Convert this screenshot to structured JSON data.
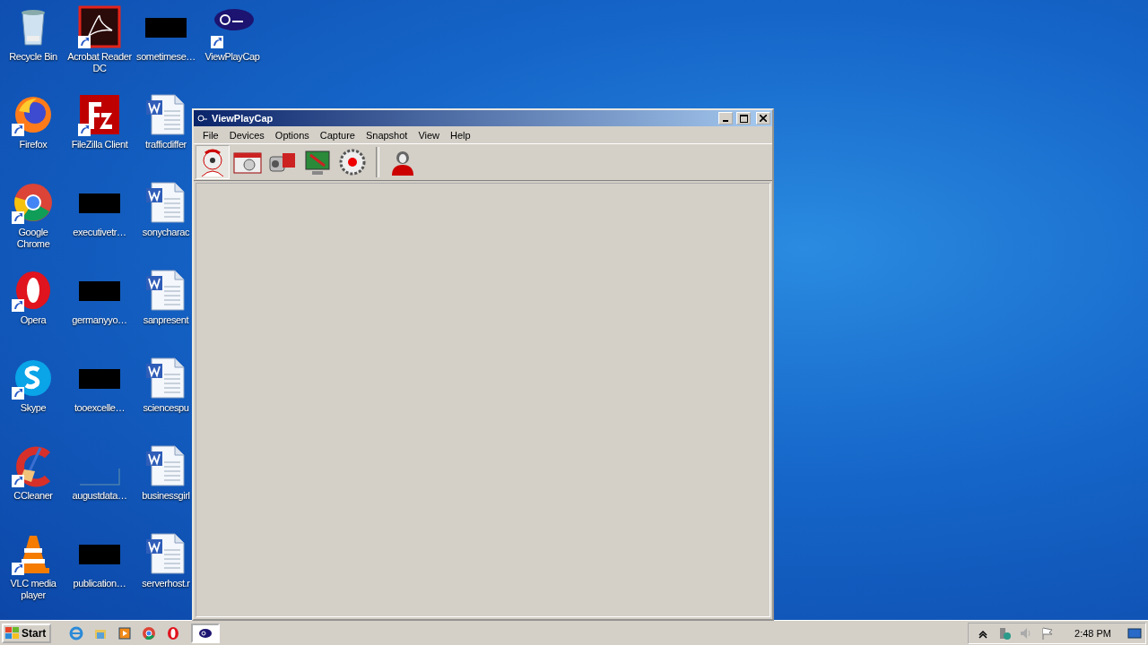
{
  "desktop_icons": [
    {
      "label": "Recycle Bin",
      "kind": "recycle",
      "shortcut": false
    },
    {
      "label": "Firefox",
      "kind": "firefox",
      "shortcut": true
    },
    {
      "label": "Google Chrome",
      "kind": "chrome",
      "shortcut": true
    },
    {
      "label": "Opera",
      "kind": "opera",
      "shortcut": true
    },
    {
      "label": "Skype",
      "kind": "skype",
      "shortcut": true
    },
    {
      "label": "CCleaner",
      "kind": "ccleaner",
      "shortcut": true
    },
    {
      "label": "VLC media player",
      "kind": "vlc",
      "shortcut": true
    },
    {
      "label": "Acrobat Reader DC",
      "kind": "pdf",
      "shortcut": true
    },
    {
      "label": "FileZilla Client",
      "kind": "filezilla",
      "shortcut": true
    },
    {
      "label": "executivetr…",
      "kind": "redacted",
      "shortcut": false
    },
    {
      "label": "germanyyo…",
      "kind": "redacted",
      "shortcut": false
    },
    {
      "label": "tooexcelle…",
      "kind": "redacted",
      "shortcut": false
    },
    {
      "label": "augustdata…",
      "kind": "blank",
      "shortcut": false
    },
    {
      "label": "publication…",
      "kind": "redacted",
      "shortcut": false
    },
    {
      "label": "sometimese…",
      "kind": "redacted",
      "shortcut": false
    },
    {
      "label": "trafficdiffer",
      "kind": "document",
      "shortcut": false
    },
    {
      "label": "sonycharac",
      "kind": "document",
      "shortcut": false
    },
    {
      "label": "sanpresent",
      "kind": "document",
      "shortcut": false
    },
    {
      "label": "sciencespu",
      "kind": "document",
      "shortcut": false
    },
    {
      "label": "businessgirl",
      "kind": "document",
      "shortcut": false
    },
    {
      "label": "serverhost.r",
      "kind": "document",
      "shortcut": false
    },
    {
      "label": "ViewPlayCap",
      "kind": "ezon",
      "shortcut": true
    }
  ],
  "window": {
    "title": "ViewPlayCap",
    "menu": [
      "File",
      "Devices",
      "Options",
      "Capture",
      "Snapshot",
      "View",
      "Help"
    ],
    "toolbar": [
      {
        "kind": "webcam",
        "selected": true
      },
      {
        "kind": "camera",
        "selected": false
      },
      {
        "kind": "camcorder",
        "selected": false
      },
      {
        "kind": "monitor",
        "selected": false
      },
      {
        "kind": "record",
        "selected": false
      },
      {
        "kind": "separator"
      },
      {
        "kind": "person",
        "selected": false
      }
    ]
  },
  "taskbar": {
    "start": "Start",
    "tasks": [
      {
        "selected": true
      }
    ],
    "clock": "2:48 PM"
  }
}
